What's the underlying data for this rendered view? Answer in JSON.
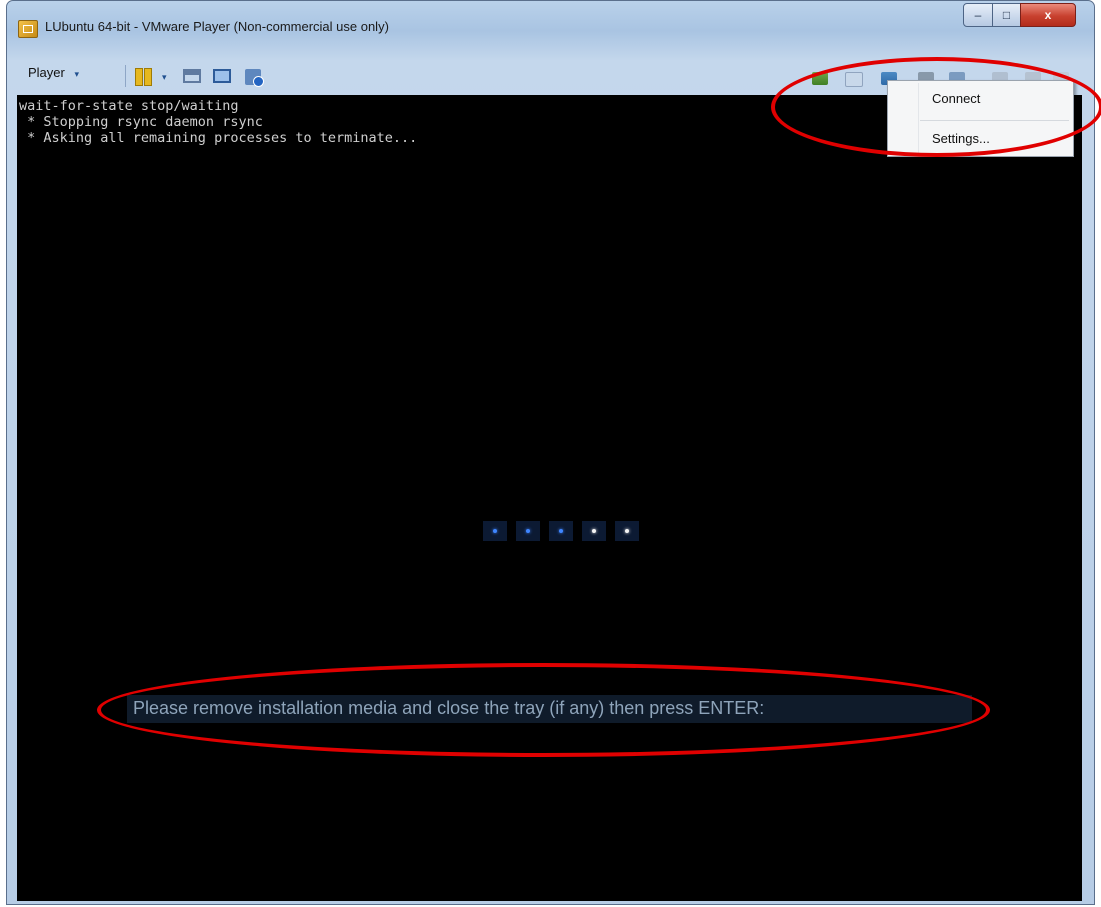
{
  "window": {
    "title": "LUbuntu 64-bit - VMware Player (Non-commercial use only)",
    "controls": {
      "minimize": "–",
      "maximize": "□",
      "close": "x"
    }
  },
  "toolbar": {
    "player_label": "Player",
    "caret": "▾"
  },
  "console": {
    "lines": [
      "wait-for-state stop/waiting",
      " * Stopping rsync daemon rsync",
      " * Asking all remaining processes to terminate..."
    ]
  },
  "boot_splash": {
    "dots": [
      "blue",
      "blue",
      "blue",
      "white",
      "white"
    ]
  },
  "prompt": "Please remove installation media and close the tray (if any) then press ENTER:",
  "context_menu": {
    "items": [
      "Connect",
      "Settings..."
    ]
  },
  "colors": {
    "annotation": "#e00000",
    "title_bar": "#b9d1ea",
    "close_button": "#c8412f"
  }
}
